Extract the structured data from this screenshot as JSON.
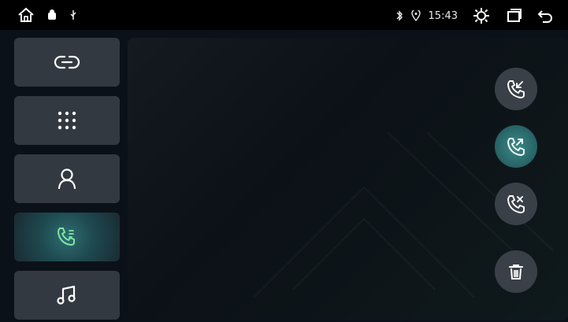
{
  "status_bar": {
    "time": "15:43",
    "icons": [
      "home-icon",
      "android-icon",
      "usb-icon",
      "bluetooth-icon",
      "location-icon",
      "brightness-icon",
      "recent-apps-icon",
      "back-icon"
    ]
  },
  "sidebar": {
    "items": [
      {
        "name": "link-icon",
        "active": false
      },
      {
        "name": "dialpad-icon",
        "active": false
      },
      {
        "name": "contacts-icon",
        "active": false
      },
      {
        "name": "call-log-icon",
        "active": true
      },
      {
        "name": "music-icon",
        "active": false
      }
    ]
  },
  "call_filters": {
    "items": [
      {
        "name": "incoming-calls-icon",
        "active": false
      },
      {
        "name": "outgoing-calls-icon",
        "active": true
      },
      {
        "name": "missed-calls-icon",
        "active": false
      },
      {
        "name": "delete-icon",
        "active": false
      }
    ]
  },
  "colors": {
    "accent": "#2f6d72",
    "icon_active": "#7de6a0",
    "button_bg": "#323941"
  }
}
